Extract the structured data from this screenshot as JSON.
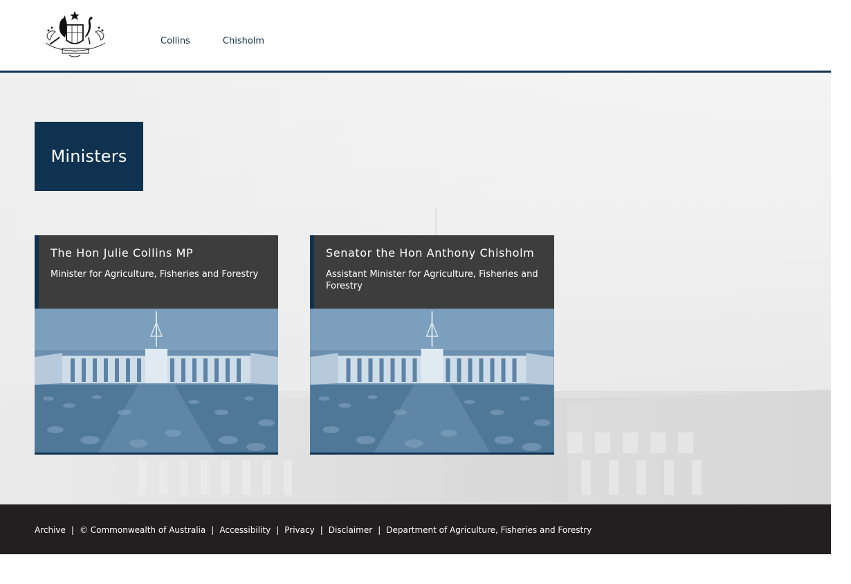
{
  "header": {
    "crest_alt": "Commonwealth Coat of Arms",
    "nav": [
      {
        "label": "Collins"
      },
      {
        "label": "Chisholm"
      }
    ]
  },
  "main": {
    "title": "Ministers",
    "cards": [
      {
        "name": "The Hon Julie Collins MP",
        "role": "Minister for Agriculture, Fisheries and Forestry"
      },
      {
        "name": "Senator the Hon Anthony Chisholm",
        "role": "Assistant Minister for Agriculture, Fisheries and Forestry"
      }
    ]
  },
  "footer": {
    "links": [
      {
        "label": "Archive"
      },
      {
        "label": "© Commonwealth of Australia"
      },
      {
        "label": "Accessibility"
      },
      {
        "label": "Privacy"
      },
      {
        "label": "Disclaimer"
      },
      {
        "label": "Department of Agriculture, Fisheries and Forestry"
      }
    ],
    "separator": "|"
  },
  "colors": {
    "primary": "#0e3250",
    "card": "#3d3d3d",
    "footer": "#231f20",
    "image_tint": "#6f96b6"
  }
}
